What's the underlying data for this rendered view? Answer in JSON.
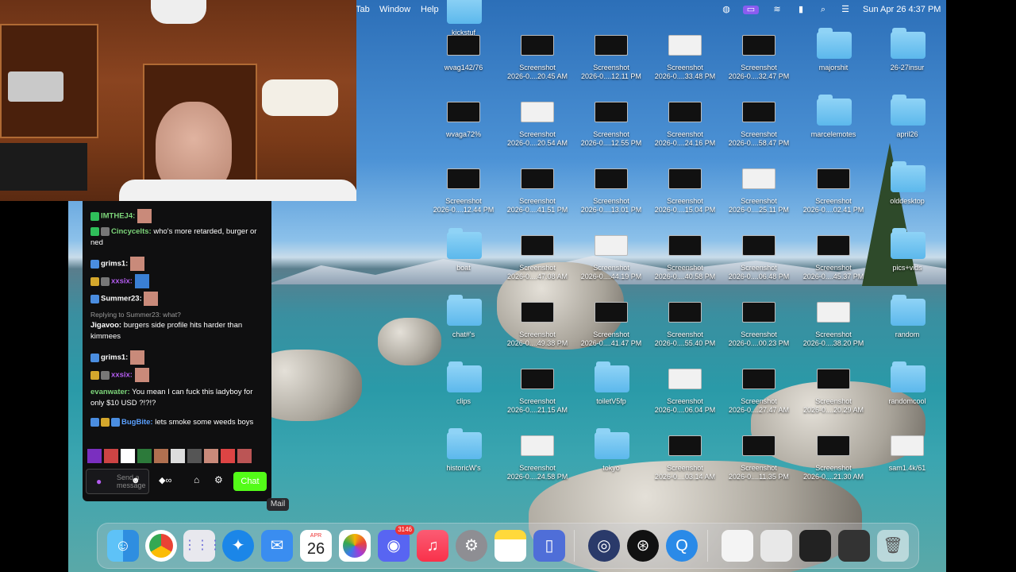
{
  "menubar": {
    "items": [
      "Tab",
      "Window",
      "Help"
    ],
    "datetime": "Sun Apr 26  4:37 PM"
  },
  "chat": {
    "messages": [
      {
        "user": "IMTHEJ4:",
        "text": "",
        "user_color": "#7dd67a"
      },
      {
        "user": "Cincycelts:",
        "text": "who's more retarded, burger or ned",
        "user_color": "#7dd67a"
      },
      {
        "user": "grims1:",
        "text": "",
        "user_color": "#ffffff"
      },
      {
        "user": "xxsix:",
        "text": "",
        "user_color": "#b45cf0"
      },
      {
        "user": "Summer23:",
        "text": "",
        "user_color": "#ffffff"
      },
      {
        "user": "Jigavoo:",
        "text": "burgers side profile hits harder than kimmees",
        "user_color": "#ffffff"
      },
      {
        "user": "grims1:",
        "text": "",
        "user_color": "#ffffff"
      },
      {
        "user": "xxsix:",
        "text": "",
        "user_color": "#b45cf0"
      },
      {
        "user": "evanwater:",
        "text": "You mean I can fuck this ladyboy for only $10 USD ?!?!?",
        "user_color": "#7dd67a"
      },
      {
        "user": "BugBite:",
        "text": "lets smoke some weeds boys",
        "user_color": "#5aa0ff"
      }
    ],
    "reply_hint": "Replying to Summer23: what?",
    "input_placeholder": "Send a message",
    "chat_button": "Chat"
  },
  "tooltip": "Mail",
  "desktop_icons": [
    {
      "label": "wvag142/76",
      "kind": "thumb"
    },
    {
      "label": "Screenshot\n2026-0....20.45 AM",
      "kind": "thumb"
    },
    {
      "label": "Screenshot\n2026-0....12.11 PM",
      "kind": "thumb"
    },
    {
      "label": "Screenshot\n2026-0....33.48 PM",
      "kind": "thumb"
    },
    {
      "label": "Screenshot\n2026-0....32.47 PM",
      "kind": "thumb"
    },
    {
      "label": "majorshit",
      "kind": "folder"
    },
    {
      "label": "26-27insur",
      "kind": "folder"
    },
    {
      "label": "wvaga72%",
      "kind": "thumb"
    },
    {
      "label": "Screenshot\n2026-0....20.54 AM",
      "kind": "thumb"
    },
    {
      "label": "Screenshot\n2026-0....12.55 PM",
      "kind": "thumb"
    },
    {
      "label": "Screenshot\n2026-0....24.16 PM",
      "kind": "thumb"
    },
    {
      "label": "Screenshot\n2026-0....58.47 PM",
      "kind": "thumb"
    },
    {
      "label": "marcelemotes",
      "kind": "folder"
    },
    {
      "label": "april26",
      "kind": "folder"
    },
    {
      "label": "Screenshot\n2026-0....12.44 PM",
      "kind": "thumb"
    },
    {
      "label": "Screenshot\n2026-0....41.51 PM",
      "kind": "thumb"
    },
    {
      "label": "Screenshot\n2026-0....13.01 PM",
      "kind": "thumb"
    },
    {
      "label": "Screenshot\n2026-0....15.04 PM",
      "kind": "thumb"
    },
    {
      "label": "Screenshot\n2026-0....25.11 PM",
      "kind": "thumb"
    },
    {
      "label": "Screenshot\n2026-0....02.41 PM",
      "kind": "thumb"
    },
    {
      "label": "olddesktop",
      "kind": "folder"
    },
    {
      "label": "boat",
      "kind": "folder"
    },
    {
      "label": "Screenshot\n2026-0....47.08 AM",
      "kind": "thumb"
    },
    {
      "label": "Screenshot\n2026-0....44.19 PM",
      "kind": "thumb"
    },
    {
      "label": "Screenshot\n2026-0....40.58 PM",
      "kind": "thumb"
    },
    {
      "label": "Screenshot\n2026-0....06.48 PM",
      "kind": "thumb"
    },
    {
      "label": "Screenshot\n2026-0....45.37 PM",
      "kind": "thumb"
    },
    {
      "label": "pics+vids",
      "kind": "folder"
    },
    {
      "label": "chat#'s",
      "kind": "folder"
    },
    {
      "label": "Screenshot\n2026-0....49.38 PM",
      "kind": "thumb"
    },
    {
      "label": "Screenshot\n2026-0....41.47 PM",
      "kind": "thumb"
    },
    {
      "label": "Screenshot\n2026-0....55.40 PM",
      "kind": "thumb"
    },
    {
      "label": "Screenshot\n2026-0....00.23 PM",
      "kind": "thumb"
    },
    {
      "label": "Screenshot\n2026-0....38.20 PM",
      "kind": "thumb"
    },
    {
      "label": "random",
      "kind": "folder"
    },
    {
      "label": "clips",
      "kind": "folder"
    },
    {
      "label": "Screenshot\n2026-0....21.15 AM",
      "kind": "thumb"
    },
    {
      "label": "toiletV5fp",
      "kind": "folder"
    },
    {
      "label": "Screenshot\n2026-0....06.04 PM",
      "kind": "thumb"
    },
    {
      "label": "Screenshot\n2026-0....27.47 AM",
      "kind": "thumb"
    },
    {
      "label": "Screenshot\n2026-0....20.29 AM",
      "kind": "thumb"
    },
    {
      "label": "randomcool",
      "kind": "folder"
    },
    {
      "label": "historicW's",
      "kind": "folder"
    },
    {
      "label": "Screenshot\n2026-0....24.58 PM",
      "kind": "thumb"
    },
    {
      "label": "tokyo",
      "kind": "folder"
    },
    {
      "label": "Screenshot\n2026-0....03.14 AM",
      "kind": "thumb"
    },
    {
      "label": "Screenshot\n2026-0....11.35 PM",
      "kind": "thumb"
    },
    {
      "label": "Screenshot\n2026-0....21.30 AM",
      "kind": "thumb"
    },
    {
      "label": "sam1.4k/61",
      "kind": "thumb"
    },
    {
      "label": "kickstuf",
      "kind": "folder"
    }
  ],
  "dock": {
    "calendar_day": "26",
    "calendar_month": "APR",
    "discord_badge": "3146",
    "apps": [
      "finder-icon",
      "chrome-icon",
      "launchpad-icon",
      "safari-icon",
      "mail-icon",
      "calendar-icon",
      "photos-icon",
      "discord-icon",
      "music-icon",
      "settings-icon",
      "notes-icon",
      "preview-icon",
      "obs-icon",
      "quicktime-icon",
      "trash-icon"
    ]
  },
  "colors": {
    "accent_green": "#53fc18",
    "folder_blue": "#6cc3f0",
    "dock_bg": "rgba(200,205,215,0.28)"
  }
}
